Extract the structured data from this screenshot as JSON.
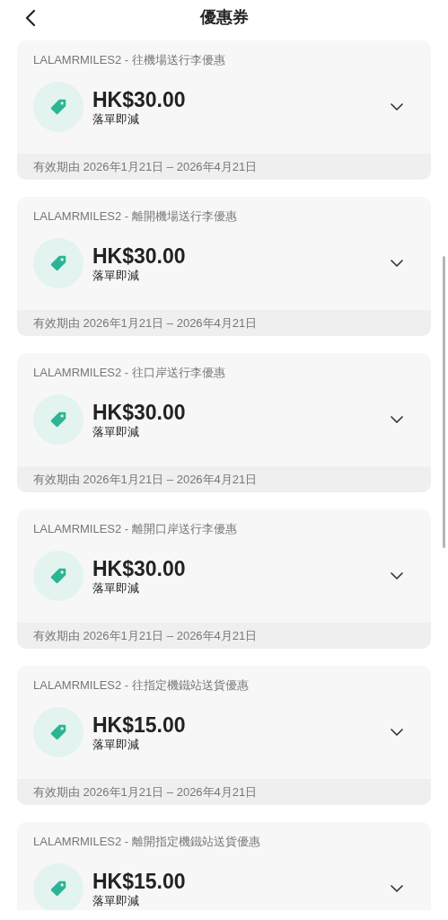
{
  "header": {
    "title": "優惠券"
  },
  "coupons": [
    {
      "title": "LALAMRMILES2 - 往機場送行李優惠",
      "amount": "HK$30.00",
      "subtitle": "落單即減",
      "validity": "有效期由 2026年1月21日 – 2026年4月21日",
      "expanded": false
    },
    {
      "title": "LALAMRMILES2 - 離開機場送行李優惠",
      "amount": "HK$30.00",
      "subtitle": "落單即減",
      "validity": "有效期由 2026年1月21日 – 2026年4月21日",
      "expanded": false
    },
    {
      "title": "LALAMRMILES2 - 往口岸送行李優惠",
      "amount": "HK$30.00",
      "subtitle": "落單即減",
      "validity": "有效期由 2026年1月21日 – 2026年4月21日",
      "expanded": false
    },
    {
      "title": "LALAMRMILES2 - 離開口岸送行李優惠",
      "amount": "HK$30.00",
      "subtitle": "落單即減",
      "validity": "有效期由 2026年1月21日 – 2026年4月21日",
      "expanded": false
    },
    {
      "title": "LALAMRMILES2 - 往指定機鐵站送貨優惠",
      "amount": "HK$15.00",
      "subtitle": "落單即減",
      "validity": "有效期由 2026年1月21日 – 2026年4月21日",
      "expanded": false
    },
    {
      "title": "LALAMRMILES2 - 離開指定機鐵站送貨優惠",
      "amount": "HK$15.00",
      "subtitle": "落單即減",
      "expanded": false
    }
  ]
}
